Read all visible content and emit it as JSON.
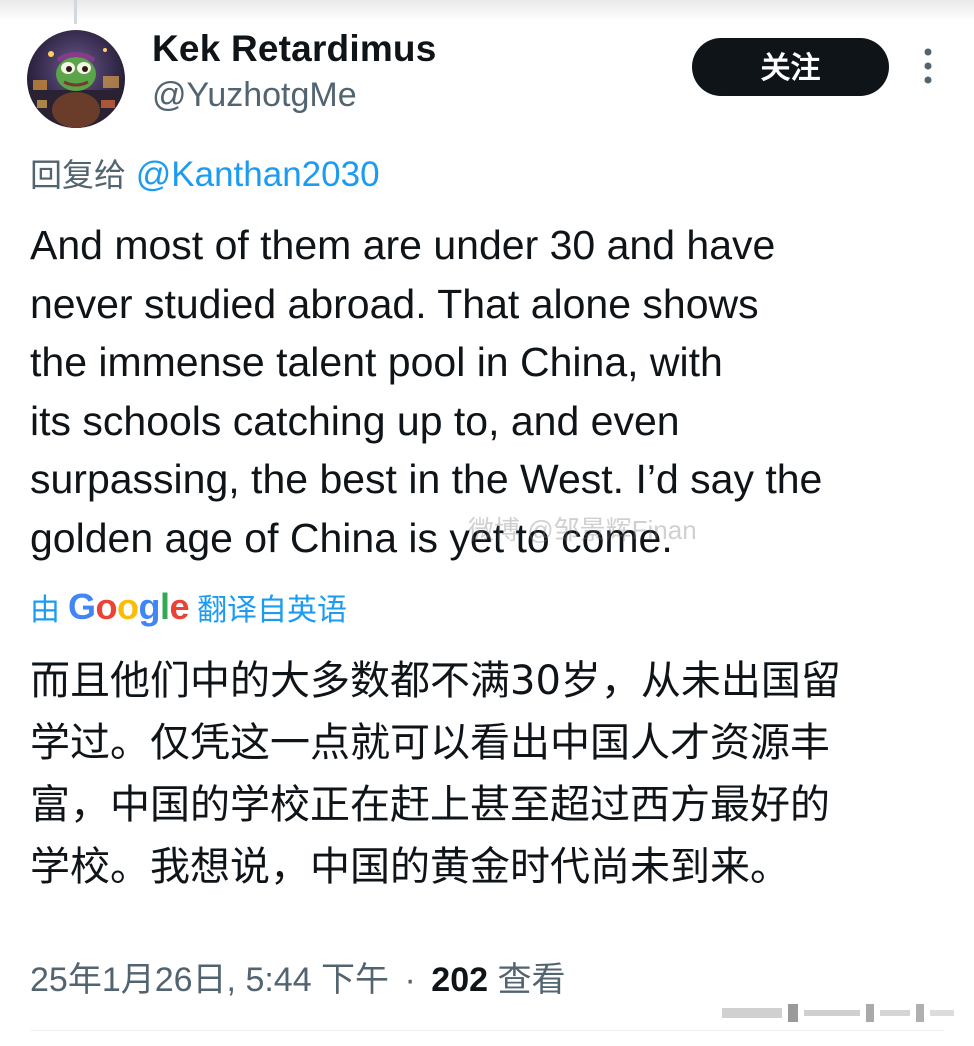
{
  "author": {
    "display_name": "Kek Retardimus",
    "handle": "@YuzhotgMe",
    "avatar_icon": "pepe-frog-avatar-icon"
  },
  "follow_button": {
    "label": "关注"
  },
  "more_menu": {
    "icon": "more-vertical-icon"
  },
  "reply": {
    "prefix": "回复给",
    "mention": "@Kanthan2030"
  },
  "tweet": {
    "text_en_lines": [
      "And most of them are under 30 and have",
      "never studied abroad. That alone shows",
      "the immense talent pool in China, with",
      "its schools catching up to, and even",
      "surpassing, the best in the West. I’d say the",
      "golden age of China is yet to come."
    ],
    "translation": {
      "by": "由",
      "provider": "Google",
      "suffix": "翻译自英语"
    },
    "text_zh_lines": [
      "而且他们中的大多数都不满30岁，从未出国留",
      "学过。仅凭这一点就可以看出中国人才资源丰",
      "富，中国的学校正在赶上甚至超过西方最好的",
      "学校。我想说，中国的黄金时代尚未到来。"
    ]
  },
  "meta": {
    "timestamp": "25年1月26日, 5:44 下午",
    "separator": "·",
    "views_count": "202",
    "views_label": "查看"
  },
  "watermark": {
    "text": "微博 @邹景辉Finan"
  },
  "colors": {
    "text_primary": "#0f1419",
    "text_secondary": "#536471",
    "link": "#1d9bf0",
    "button_bg": "#0f1419"
  }
}
